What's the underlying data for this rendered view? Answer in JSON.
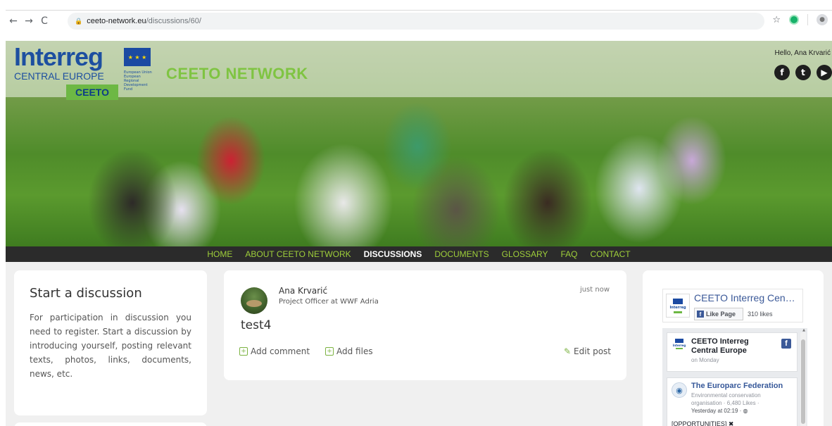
{
  "browser": {
    "back": "←",
    "forward": "→",
    "reload": "C",
    "url_host": "ceeto-network.eu",
    "url_path": "/discussions/60/"
  },
  "header": {
    "logo_word": "Interreg",
    "logo_sub": "CENTRAL EUROPE",
    "logo_fine": "European Union European Regional Development Fund",
    "badge": "CEETO",
    "site_title": "CEETO NETWORK",
    "greeting": "Hello, Ana Krvarić",
    "social": [
      "f",
      "t",
      "▶"
    ]
  },
  "nav": {
    "items": [
      {
        "label": "HOME"
      },
      {
        "label": "ABOUT CEETO NETWORK"
      },
      {
        "label": "DISCUSSIONS"
      },
      {
        "label": "DOCUMENTS"
      },
      {
        "label": "GLOSSARY"
      },
      {
        "label": "FAQ"
      },
      {
        "label": "CONTACT"
      }
    ],
    "active_index": 2
  },
  "sidebar": {
    "title": "Start a discussion",
    "text": "For participation in discussion you need to register. Start a discussion by introducing yourself, posting relevant texts, photos, links, documents, news, etc."
  },
  "post": {
    "author": "Ana Krvarić",
    "role": "Project Officer at WWF Adria",
    "time": "just now",
    "title": "test4",
    "add_comment": "Add comment",
    "add_files": "Add files",
    "edit_post": "Edit post"
  },
  "facebook": {
    "page_name": "CEETO Interreg Cen…",
    "like_label": "Like Page",
    "likes": "310 likes",
    "logo_text": "Interreg",
    "feed": [
      {
        "name": "CEETO Interreg Central Europe",
        "time": "on Monday"
      },
      {
        "name": "The Europarc Federation",
        "desc": "Environmental conservation organisation · 6,480 Likes ·",
        "time": "Yesterday at 02:19 · ",
        "text": "[OPPORTUNITIES] ✖"
      }
    ]
  },
  "colors": {
    "accent_green": "#9fcf3a",
    "nav_bg": "#2b2b2b",
    "interreg_blue": "#1d4fa0",
    "facebook_blue": "#3b5998"
  }
}
